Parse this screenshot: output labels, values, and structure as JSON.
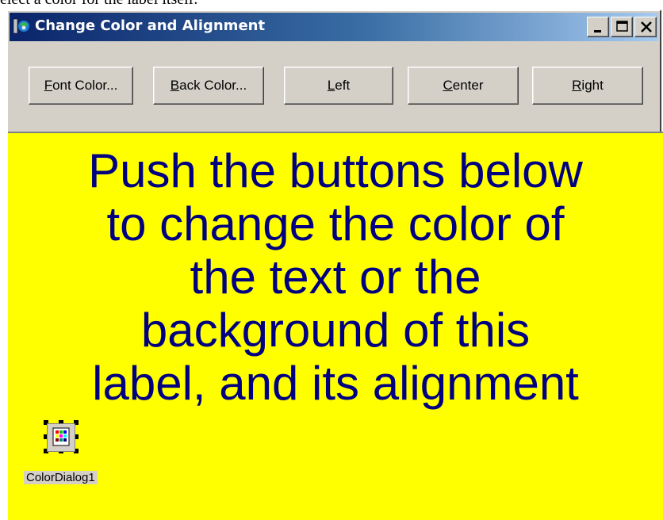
{
  "caption": "elect a color for the label itself.",
  "window": {
    "title": "Change Color and Alignment",
    "controls": [
      "minimize-icon",
      "maximize-icon",
      "close-icon"
    ]
  },
  "buttons": [
    {
      "label": "Font Color...",
      "name": "font-color-button"
    },
    {
      "label": "Back Color...",
      "name": "back-color-button"
    },
    {
      "label": "Left",
      "name": "left-align-button"
    },
    {
      "label": "Center",
      "name": "center-align-button"
    },
    {
      "label": "Right",
      "name": "right-align-button"
    }
  ],
  "label": {
    "text": "Push the buttons below\nto change the color of\nthe text or the\nbackground of this\nlabel, and its alignment",
    "fore_color": "#000080",
    "back_color": "#ffff00"
  },
  "component": {
    "name": "ColorDialog1",
    "icon": "color-dialog-icon"
  },
  "colors": {
    "form": "#d4d0c8",
    "titlebar_start": "#0a246a",
    "titlebar_end": "#a6caf0"
  }
}
